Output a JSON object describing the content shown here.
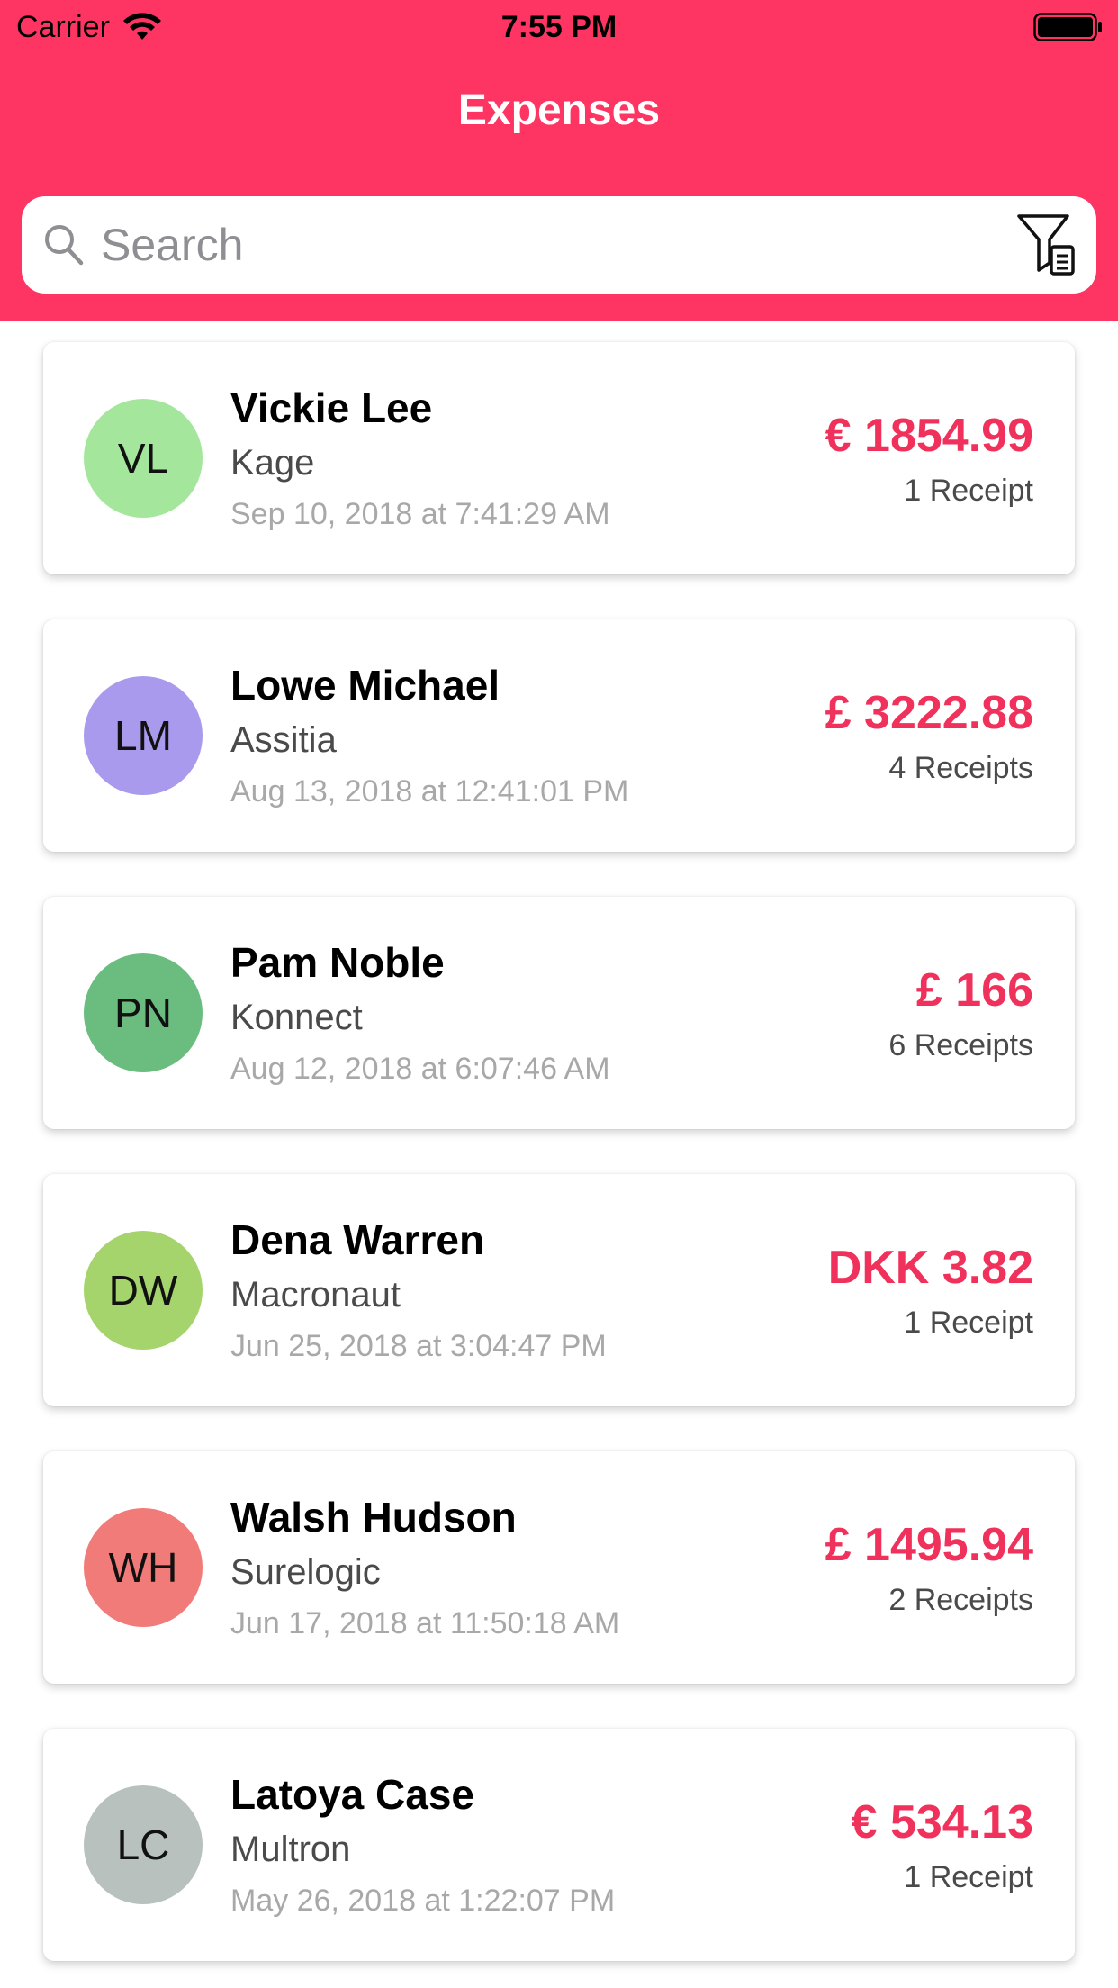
{
  "status_bar": {
    "carrier": "Carrier",
    "time": "7:55 PM"
  },
  "nav": {
    "title": "Expenses"
  },
  "search": {
    "placeholder": "Search",
    "value": ""
  },
  "colors": {
    "header": "#fe3562",
    "amount": "#f0315b"
  },
  "expenses": [
    {
      "initials": "VL",
      "name": "Vickie Lee",
      "company": "Kage",
      "date": "Sep 10, 2018 at 7:41:29 AM",
      "amount": "€ 1854.99",
      "receipts": "1 Receipt",
      "avatar_color": "#a4e79c"
    },
    {
      "initials": "LM",
      "name": "Lowe Michael",
      "company": "Assitia",
      "date": "Aug 13, 2018 at 12:41:01 PM",
      "amount": "£ 3222.88",
      "receipts": "4 Receipts",
      "avatar_color": "#a99aed"
    },
    {
      "initials": "PN",
      "name": "Pam Noble",
      "company": "Konnect",
      "date": "Aug 12, 2018 at 6:07:46 AM",
      "amount": "£ 166",
      "receipts": "6 Receipts",
      "avatar_color": "#6bbd7f"
    },
    {
      "initials": "DW",
      "name": "Dena Warren",
      "company": "Macronaut",
      "date": "Jun 25, 2018 at 3:04:47 PM",
      "amount": "DKK 3.82",
      "receipts": "1 Receipt",
      "avatar_color": "#a5d46c"
    },
    {
      "initials": "WH",
      "name": "Walsh Hudson",
      "company": "Surelogic",
      "date": "Jun 17, 2018 at 11:50:18 AM",
      "amount": "£ 1495.94",
      "receipts": "2 Receipts",
      "avatar_color": "#f17b78"
    },
    {
      "initials": "LC",
      "name": "Latoya Case",
      "company": "Multron",
      "date": "May 26, 2018 at 1:22:07 PM",
      "amount": "€ 534.13",
      "receipts": "1 Receipt",
      "avatar_color": "#b8c1bd"
    }
  ]
}
